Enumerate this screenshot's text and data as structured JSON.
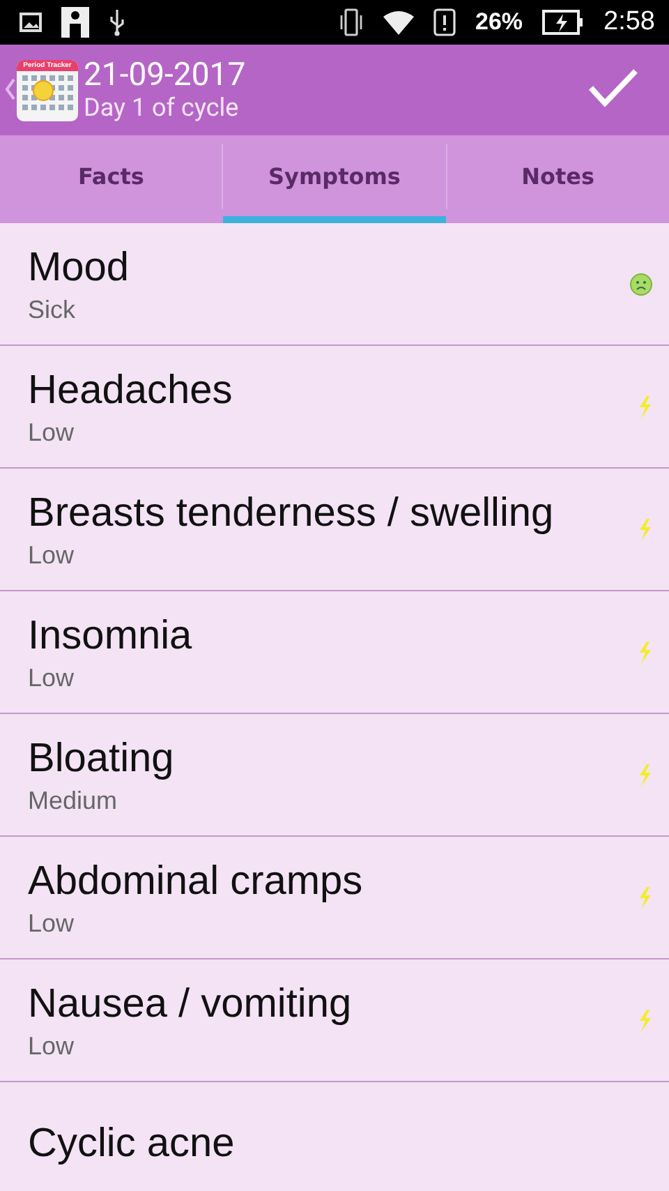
{
  "status_bar": {
    "battery": "26%",
    "time": "2:58"
  },
  "header": {
    "app_icon_label": "Period Tracker",
    "date": "21-09-2017",
    "subtitle": "Day 1 of cycle"
  },
  "tabs": [
    {
      "label": "Facts",
      "selected": false
    },
    {
      "label": "Symptoms",
      "selected": true
    },
    {
      "label": "Notes",
      "selected": false
    }
  ],
  "symptoms": [
    {
      "name": "Mood",
      "value": "Sick",
      "kind": "mood"
    },
    {
      "name": "Headaches",
      "value": "Low",
      "kind": "bolt"
    },
    {
      "name": "Breasts tenderness / swelling",
      "value": "Low",
      "kind": "bolt"
    },
    {
      "name": "Insomnia",
      "value": "Low",
      "kind": "bolt"
    },
    {
      "name": "Bloating",
      "value": "Medium",
      "kind": "bolt"
    },
    {
      "name": "Abdominal cramps",
      "value": "Low",
      "kind": "bolt"
    },
    {
      "name": "Nausea / vomiting",
      "value": "Low",
      "kind": "bolt"
    },
    {
      "name": "Cyclic acne",
      "kind": "none"
    }
  ]
}
